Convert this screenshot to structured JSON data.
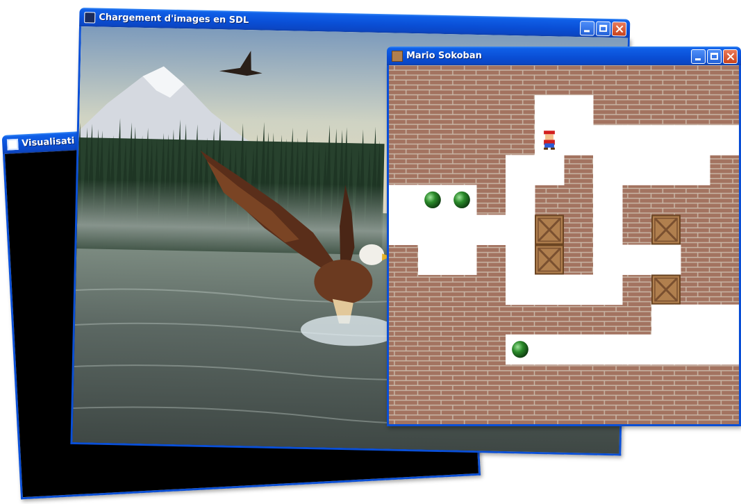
{
  "windows": {
    "visualisation": {
      "title": "Visualisati",
      "icon": "window-icon"
    },
    "sdl_image": {
      "title": "Chargement d'images en SDL",
      "icon": "sdl-icon",
      "content": "eagle-over-lake-image"
    },
    "sokoban": {
      "title": "Mario Sokoban",
      "icon": "crate-icon"
    }
  },
  "controls": {
    "minimize": "minimize-icon",
    "maximize": "maximize-icon",
    "close": "close-icon"
  },
  "sokoban_grid": [
    "WWWWWWWWWWWW",
    "WWWWWFFWWWWW",
    "WWWWWMFFFFFF",
    "WWWWFFWFFFFW",
    "FGGWFWWFWWWW",
    "FFFFFBWFWBWW",
    "WFFWFBWFFFWW",
    "WWWWFFFFWBWW",
    "WWWWWWWWWFFF",
    "WWWWGFFFFFFF",
    "WWWWWWWWWWWW",
    "WWWWWWWWWWWW"
  ],
  "colors": {
    "titlebar": "#0a4fd6",
    "brick": "#a37360",
    "mortar": "#c9b6a6",
    "floor": "#ffffff",
    "goal": "#2a8a2a",
    "crate": "#b07f4e",
    "viz_top": "#e8380c",
    "viz_mid": "#a69a0e",
    "viz_bottom": "#35e83a"
  }
}
